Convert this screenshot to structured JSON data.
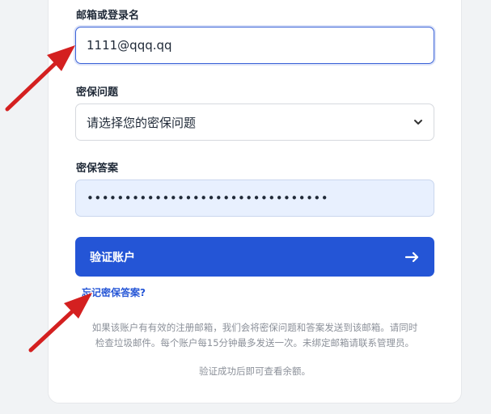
{
  "form": {
    "email_label": "邮箱或登录名",
    "email_value": "1111@qqq.qq",
    "question_label": "密保问题",
    "question_selected": "请选择您的密保问题",
    "answer_label": "密保答案",
    "answer_masked": "••••••••••••••••••••••••••••••••",
    "submit_label": "验证账户",
    "submit_icon": "arrow-right-icon",
    "forgot_link": "忘记密保答案?",
    "note_line1": "如果该账户有有效的注册邮箱，我们会将密保问题和答案发送到该邮箱。请同时",
    "note_line2": "检查垃圾邮件。每个账户每15分钟最多发送一次。未绑定邮箱请联系管理员。",
    "footer_note": "验证成功后即可查看余额。"
  },
  "colors": {
    "accent": "#2455d6",
    "annotation_arrow": "#d42020"
  }
}
